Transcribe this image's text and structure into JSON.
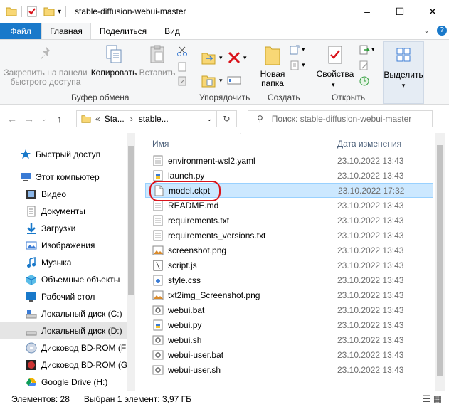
{
  "window": {
    "title": "stable-diffusion-webui-master",
    "minimize": "–",
    "maximize": "☐",
    "close": "✕"
  },
  "tabs": {
    "file": "Файл",
    "home": "Главная",
    "share": "Поделиться",
    "view": "Вид",
    "help": "?"
  },
  "ribbon": {
    "pin": "Закрепить на панели быстрого доступа",
    "pin_l1": "Закрепить на панели",
    "pin_l2": "быстрого доступа",
    "copy": "Копировать",
    "paste": "Вставить",
    "clipboard_group": "Буфер обмена",
    "organize_group": "Упорядочить",
    "new_folder_l1": "Новая",
    "new_folder_l2": "папка",
    "create_group": "Создать",
    "properties": "Свойства",
    "open_group": "Открыть",
    "select": "Выделить"
  },
  "address": {
    "path_part1": "Sta...",
    "path_part2": "stable...",
    "search_placeholder": "Поиск: stable-diffusion-webui-master"
  },
  "nav": {
    "items": [
      {
        "label": "Быстрый доступ",
        "icon": "star-icon"
      },
      {
        "label": "Этот компьютер",
        "icon": "computer-icon"
      },
      {
        "label": "Видео",
        "icon": "video-icon"
      },
      {
        "label": "Документы",
        "icon": "documents-icon"
      },
      {
        "label": "Загрузки",
        "icon": "download-icon"
      },
      {
        "label": "Изображения",
        "icon": "pictures-icon"
      },
      {
        "label": "Музыка",
        "icon": "music-icon"
      },
      {
        "label": "Объемные объекты",
        "icon": "3d-objects-icon"
      },
      {
        "label": "Рабочий стол",
        "icon": "desktop-icon"
      },
      {
        "label": "Локальный диск (C:)",
        "icon": "drive-icon"
      },
      {
        "label": "Локальный диск (D:)",
        "icon": "drive-icon"
      },
      {
        "label": "Дисковод BD-ROM (F:)",
        "icon": "disc-icon"
      },
      {
        "label": "Дисковод BD-ROM (G:)",
        "icon": "disc-icon"
      },
      {
        "label": "Google Drive (H:)",
        "icon": "google-drive-icon"
      }
    ],
    "selected": "Локальный диск (D:)"
  },
  "columns": {
    "name": "Имя",
    "date": "Дата изменения"
  },
  "files": [
    {
      "name": "environment-wsl2.yaml",
      "date": "23.10.2022 13:43",
      "icon": "text-file-icon"
    },
    {
      "name": "launch.py",
      "date": "23.10.2022 13:43",
      "icon": "python-file-icon"
    },
    {
      "name": "model.ckpt",
      "date": "23.10.2022 17:32",
      "icon": "blank-file-icon"
    },
    {
      "name": "README.md",
      "date": "23.10.2022 13:43",
      "icon": "text-file-icon"
    },
    {
      "name": "requirements.txt",
      "date": "23.10.2022 13:43",
      "icon": "text-file-icon"
    },
    {
      "name": "requirements_versions.txt",
      "date": "23.10.2022 13:43",
      "icon": "text-file-icon"
    },
    {
      "name": "screenshot.png",
      "date": "23.10.2022 13:43",
      "icon": "image-file-icon"
    },
    {
      "name": "script.js",
      "date": "23.10.2022 13:43",
      "icon": "script-file-icon"
    },
    {
      "name": "style.css",
      "date": "23.10.2022 13:43",
      "icon": "css-file-icon"
    },
    {
      "name": "txt2img_Screenshot.png",
      "date": "23.10.2022 13:43",
      "icon": "image-file-icon"
    },
    {
      "name": "webui.bat",
      "date": "23.10.2022 13:43",
      "icon": "batch-file-icon"
    },
    {
      "name": "webui.py",
      "date": "23.10.2022 13:43",
      "icon": "python-file-icon"
    },
    {
      "name": "webui.sh",
      "date": "23.10.2022 13:43",
      "icon": "batch-file-icon"
    },
    {
      "name": "webui-user.bat",
      "date": "23.10.2022 13:43",
      "icon": "batch-file-icon"
    },
    {
      "name": "webui-user.sh",
      "date": "23.10.2022 13:43",
      "icon": "batch-file-icon"
    }
  ],
  "selected_file": "model.ckpt",
  "status": {
    "count": "Элементов: 28",
    "selection": "Выбран 1 элемент: 3,97 ГБ"
  },
  "colors": {
    "file_tab": "#1979ca",
    "selection": "#cce8ff",
    "highlight_ring": "#d9131b",
    "folder": "#f8d775"
  }
}
